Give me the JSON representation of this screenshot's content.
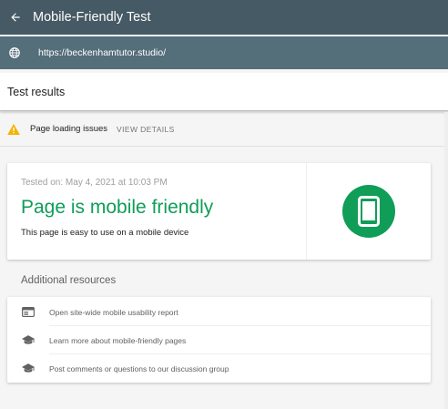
{
  "appbar": {
    "title": "Mobile-Friendly Test",
    "back_icon": "arrow-back-icon",
    "color": "#455a64"
  },
  "urlbar": {
    "url": "https://beckenhamtutor.studio/",
    "globe_icon": "globe-icon",
    "color": "#546e7a"
  },
  "results": {
    "title": "Test results"
  },
  "issues": {
    "label": "Page loading issues",
    "action": "VIEW DETAILS",
    "warning_icon": "warning-icon",
    "warning_color": "#f4b400"
  },
  "result_card": {
    "tested_on": "Tested on: May 4, 2021 at 10:03 PM",
    "verdict": "Page is mobile friendly",
    "description": "This page is easy to use on a mobile device",
    "badge_icon": "smartphone-icon",
    "verdict_color": "#0f9d58"
  },
  "resources": {
    "heading": "Additional resources",
    "items": [
      {
        "label": "Open site-wide mobile usability report",
        "icon": "web-report-icon"
      },
      {
        "label": "Learn more about mobile-friendly pages",
        "icon": "school-icon"
      },
      {
        "label": "Post comments or questions to our discussion group",
        "icon": "school-icon"
      }
    ]
  }
}
